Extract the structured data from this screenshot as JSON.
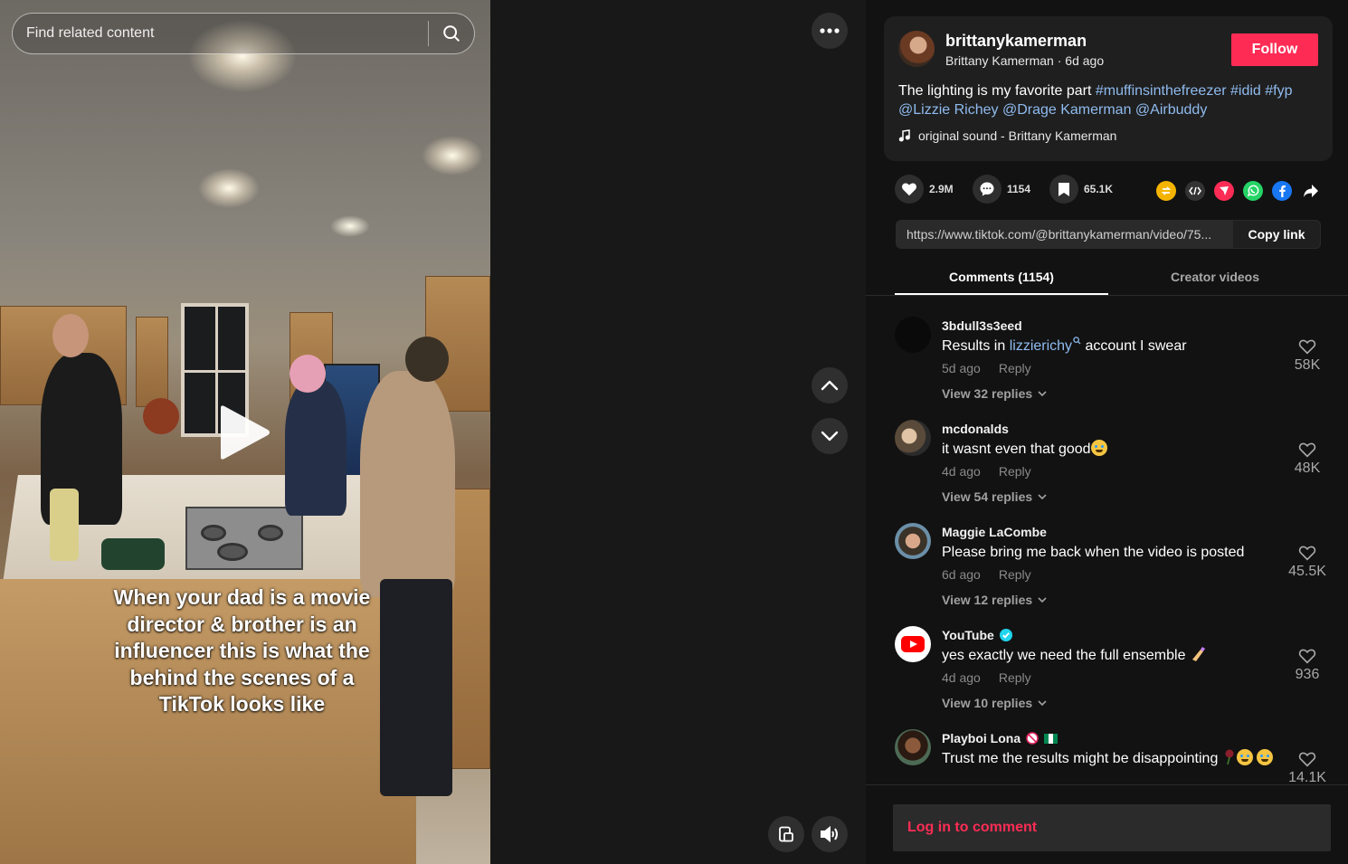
{
  "search": {
    "placeholder": "Find related content"
  },
  "video": {
    "overlay_caption": "When your dad is a movie director & brother is an influencer this is what the behind the scenes of a TikTok looks like",
    "controls": {
      "more": "more-options",
      "prev": "previous-video",
      "next": "next-video",
      "pip": "picture-in-picture",
      "volume": "volume"
    }
  },
  "author": {
    "username": "brittanykamerman",
    "display_name": "Brittany Kamerman",
    "posted": "6d ago",
    "meta_separator": " · ",
    "follow_label": "Follow"
  },
  "description": {
    "text": "The lighting is my favorite part ",
    "tags": [
      "#muffinsinthefreezer",
      "#idid",
      "#fyp",
      "@Lizzie Richey",
      "@Drage Kamerman",
      "@Airbuddy"
    ]
  },
  "sound": {
    "label": "original sound - Brittany Kamerman"
  },
  "stats": {
    "likes": "2.9M",
    "comments": "1154",
    "saves": "65.1K"
  },
  "share_icons": [
    "repost-icon",
    "embed-icon",
    "send-icon",
    "whatsapp-icon",
    "facebook-icon",
    "share-arrow-icon"
  ],
  "link": {
    "url": "https://www.tiktok.com/@brittanykamerman/video/75...",
    "copy_label": "Copy link"
  },
  "tabs": {
    "comments": "Comments (1154)",
    "creator": "Creator videos"
  },
  "comments": [
    {
      "user": "3bdull3s3eed",
      "text_before": "Results in ",
      "mention": "lizzierichy",
      "text_after": " account I swear",
      "time": "5d ago",
      "reply": "Reply",
      "view_replies": "View 32 replies",
      "likes": "58K"
    },
    {
      "user": "mcdonalds",
      "text": "it wasnt even that good",
      "time": "4d ago",
      "reply": "Reply",
      "view_replies": "View 54 replies",
      "likes": "48K"
    },
    {
      "user": "Maggie LaCombe",
      "text": "Please bring me back when the video is posted",
      "time": "6d ago",
      "reply": "Reply",
      "view_replies": "View 12 replies",
      "likes": "45.5K"
    },
    {
      "user": "YouTube",
      "text": "yes exactly we need the full ensemble",
      "time": "4d ago",
      "reply": "Reply",
      "view_replies": "View 10 replies",
      "likes": "936"
    },
    {
      "user": "Playboi Lona",
      "text": "Trust me the results might be disappointing",
      "likes": "14.1K"
    }
  ],
  "comment_box": {
    "login_label": "Log in to comment"
  },
  "colors": {
    "accent": "#fe2c55",
    "link": "#8fbbef",
    "panel_bg": "#121212",
    "card_bg": "#1f1f1f"
  }
}
